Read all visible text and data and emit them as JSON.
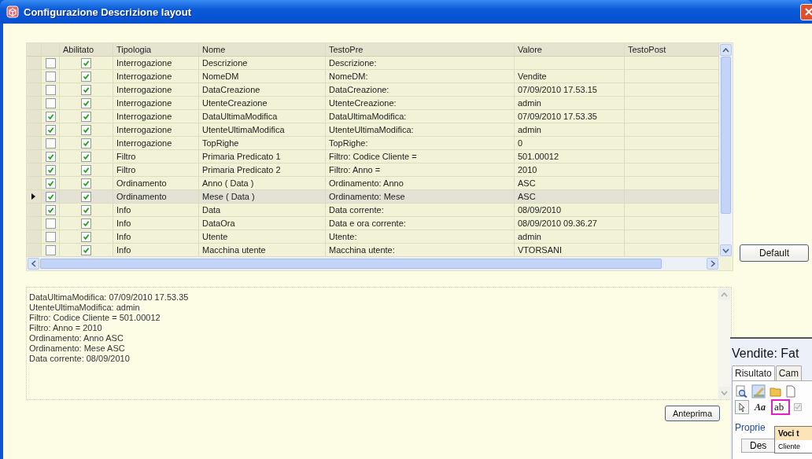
{
  "window": {
    "title": "Configurazione Descrizione layout"
  },
  "grid": {
    "columns": [
      "Abilitato",
      "Tipologia",
      "Nome",
      "TestoPre",
      "Valore",
      "TestoPost"
    ],
    "rows": [
      {
        "selected": false,
        "checked": false,
        "abilitato": true,
        "tipologia": "Interrogazione",
        "nome": "Descrizione",
        "testo_pre": "Descrizione:",
        "valore": ""
      },
      {
        "selected": false,
        "checked": false,
        "abilitato": true,
        "tipologia": "Interrogazione",
        "nome": "NomeDM",
        "testo_pre": "NomeDM:",
        "valore": "Vendite"
      },
      {
        "selected": false,
        "checked": false,
        "abilitato": true,
        "tipologia": "Interrogazione",
        "nome": "DataCreazione",
        "testo_pre": "DataCreazione:",
        "valore": "07/09/2010 17.53.15"
      },
      {
        "selected": false,
        "checked": false,
        "abilitato": true,
        "tipologia": "Interrogazione",
        "nome": "UtenteCreazione",
        "testo_pre": "UtenteCreazione:",
        "valore": "admin"
      },
      {
        "selected": false,
        "checked": true,
        "abilitato": true,
        "tipologia": "Interrogazione",
        "nome": "DataUltimaModifica",
        "testo_pre": "DataUltimaModifica:",
        "valore": "07/09/2010 17.53.35"
      },
      {
        "selected": false,
        "checked": true,
        "abilitato": true,
        "tipologia": "Interrogazione",
        "nome": "UtenteUltimaModifica",
        "testo_pre": "UtenteUltimaModifica:",
        "valore": "admin"
      },
      {
        "selected": false,
        "checked": false,
        "abilitato": true,
        "tipologia": "Interrogazione",
        "nome": "TopRighe",
        "testo_pre": "TopRighe:",
        "valore": "0"
      },
      {
        "selected": false,
        "checked": true,
        "abilitato": true,
        "tipologia": "Filtro",
        "nome": "Primaria Predicato 1",
        "testo_pre": "Filtro: Codice Cliente =",
        "valore": "501.00012"
      },
      {
        "selected": false,
        "checked": true,
        "abilitato": true,
        "tipologia": "Filtro",
        "nome": "Primaria Predicato 2",
        "testo_pre": "Filtro: Anno =",
        "valore": "2010"
      },
      {
        "selected": false,
        "checked": true,
        "abilitato": true,
        "tipologia": "Ordinamento",
        "nome": "Anno ( Data )",
        "testo_pre": "Ordinamento: Anno",
        "valore": "ASC"
      },
      {
        "selected": true,
        "checked": true,
        "abilitato": true,
        "tipologia": "Ordinamento",
        "nome": "Mese ( Data )",
        "testo_pre": "Ordinamento: Mese",
        "valore": "ASC"
      },
      {
        "selected": false,
        "checked": true,
        "abilitato": true,
        "tipologia": "Info",
        "nome": "Data",
        "testo_pre": "Data corrente:",
        "valore": "08/09/2010"
      },
      {
        "selected": false,
        "checked": false,
        "abilitato": true,
        "tipologia": "Info",
        "nome": "DataOra",
        "testo_pre": "Data e ora corrente:",
        "valore": "08/09/2010 09.36.27"
      },
      {
        "selected": false,
        "checked": false,
        "abilitato": true,
        "tipologia": "Info",
        "nome": "Utente",
        "testo_pre": "Utente:",
        "valore": "admin"
      },
      {
        "selected": false,
        "checked": false,
        "abilitato": true,
        "tipologia": "Info",
        "nome": "Macchina utente",
        "testo_pre": "Macchina utente:",
        "valore": "VTORSANI"
      }
    ]
  },
  "default_button": "Default",
  "preview_lines": [
    "DataUltimaModifica: 07/09/2010 17.53.35",
    "UtenteUltimaModifica: admin",
    "Filtro: Codice Cliente = 501.00012",
    "Filtro: Anno = 2010",
    "Ordinamento: Anno  ASC",
    "Ordinamento: Mese  ASC",
    "Data corrente: 08/09/2010"
  ],
  "preview_button": "Anteprima",
  "background_window": {
    "title": "Vendite: Fat",
    "tabs": [
      {
        "label": "Risultato",
        "selected": true
      },
      {
        "label": "Cam",
        "selected": false
      }
    ],
    "font_tool": "Aa",
    "text_tool": "ab",
    "group_label": "Proprie",
    "tooltip": "Voci t",
    "tooltip_item": "Cliente",
    "desc_button": "Des"
  }
}
